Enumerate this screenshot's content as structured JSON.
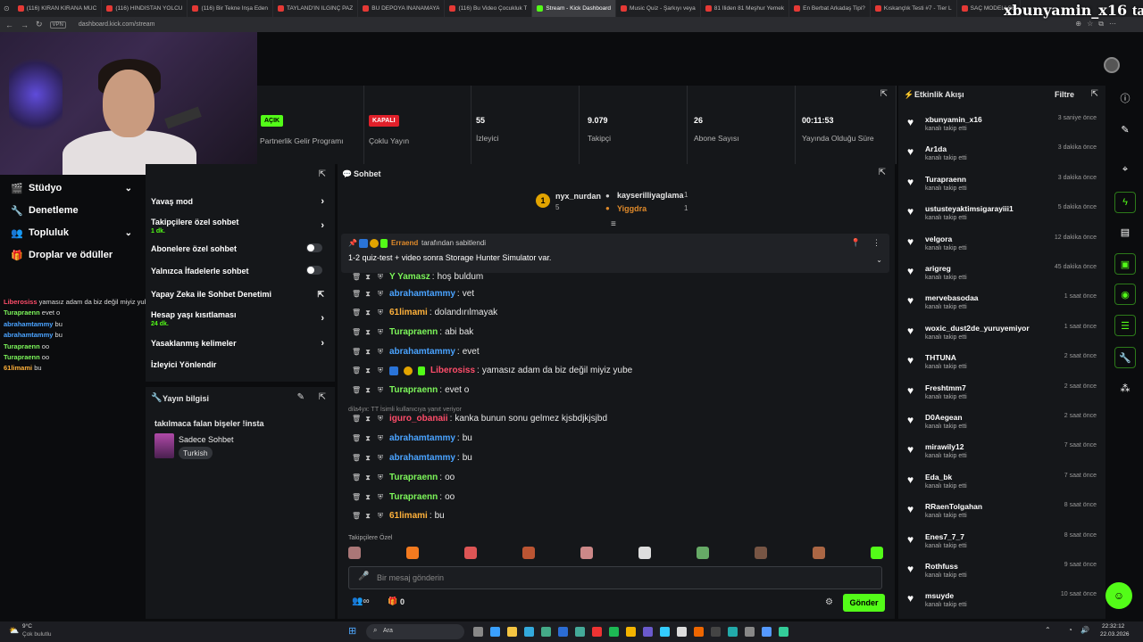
{
  "browser": {
    "tabs": [
      {
        "label": "(116) KIRAN KIRANA MÜC"
      },
      {
        "label": "(116) HİNDİSTAN YOLCU"
      },
      {
        "label": "(116) Bir Tekne İnşa Eden"
      },
      {
        "label": "TAYLAND'IN İLGİNÇ PAZ"
      },
      {
        "label": "BU DEPOYA İNANAMAYA"
      },
      {
        "label": "(116) Bu Video Çocukluk T"
      },
      {
        "label": "Stream - Kick Dashboard",
        "active": true
      },
      {
        "label": "Music Quiz - Şarkıyı veya"
      },
      {
        "label": "81 İliden 81 Meşhur Yemek"
      },
      {
        "label": "En Berbat Arkadaş Tipi?"
      },
      {
        "label": "Kıskançlık Testi #7 - Tier L"
      },
      {
        "label": "SAÇ MODELİ SE"
      }
    ],
    "url": "dashboard.kick.com/stream",
    "vpn_label": "VPN",
    "overlay_user": "xbunyamin_x16",
    "overlay_suffix": "takip"
  },
  "left_nav": [
    {
      "label": "Stüdyo",
      "icon": "film-icon",
      "chevron": true
    },
    {
      "label": "Denetleme",
      "icon": "wrench-icon",
      "chevron": false
    },
    {
      "label": "Topluluk",
      "icon": "people-icon",
      "chevron": true
    },
    {
      "label": "Droplar ve ödüller",
      "icon": "gift-icon",
      "chevron": false
    }
  ],
  "chat_overlay": [
    {
      "user": "Liberosiss",
      "text": "yamasız adam da biz değil miyiz yube",
      "color": "#ff4d6a"
    },
    {
      "user": "Turapraenn",
      "text": "evet o",
      "color": "#7cf55a"
    },
    {
      "user": "abrahamtammy",
      "text": "bu",
      "color": "#4aa3ff"
    },
    {
      "user": "abrahamtammy",
      "text": "bu",
      "color": "#4aa3ff"
    },
    {
      "user": "Turapraenn",
      "text": "oo",
      "color": "#7cf55a"
    },
    {
      "user": "Turapraenn",
      "text": "oo",
      "color": "#7cf55a"
    },
    {
      "user": "61limami",
      "text": "bu",
      "color": "#ffb13b"
    }
  ],
  "stats": [
    {
      "badge": "AÇIK",
      "badge_color": "#53fc18",
      "label": "Partnerlik Gelir Programı"
    },
    {
      "badge": "KAPALI",
      "badge_color": "#e0202a",
      "label": "Çoklu Yayın"
    },
    {
      "value": "55",
      "label": "İzleyici"
    },
    {
      "value": "9.079",
      "label": "Takipçi"
    },
    {
      "value": "26",
      "label": "Abone Sayısı"
    },
    {
      "value": "00:11:53",
      "label": "Yayında Olduğu Süre"
    }
  ],
  "chat_settings": {
    "rows": [
      {
        "label": "Yavaş mod",
        "type": "arrow"
      },
      {
        "label": "Takipçilere özel sohbet",
        "sub": "1 dk.",
        "type": "arrow"
      },
      {
        "label": "Abonelere özel sohbet",
        "type": "toggle"
      },
      {
        "label": "Yalnızca İfadelerle sohbet",
        "type": "toggle"
      },
      {
        "label": "Yapay Zeka ile Sohbet Denetimi",
        "type": "external"
      },
      {
        "label": "Hesap yaşı kısıtlaması",
        "sub": "24 dk.",
        "type": "arrow"
      },
      {
        "label": "Yasaklanmış kelimeler",
        "type": "arrow"
      },
      {
        "label": "İzleyici Yönlendir",
        "type": "none"
      }
    ]
  },
  "stream_info": {
    "title": "Yayın bilgisi",
    "stream_title": "takılmaca falan bişeler !insta",
    "category": "Sadece Sohbet",
    "language": "Turkish"
  },
  "chat": {
    "title": "Sohbet",
    "top_gifters": [
      {
        "name": "nyx_nurdan",
        "count": "5"
      },
      {
        "name": "kayserilliyaglama",
        "count": "1"
      },
      {
        "name": "Yiggdra",
        "count": "1"
      }
    ],
    "pinned": {
      "pinned_by": "Erraend",
      "pinned_by_suffix": "tarafından sabitlendi",
      "text": "1-2 quiz-test + video sonra Storage Hunter Simulator var."
    },
    "reply_hint": "dila4yx: TT İsimli kullanıcıya yanıt veriyor",
    "messages": [
      {
        "user": "Y Yamasz",
        "text": "hoş buldum",
        "color": "#7cf55a"
      },
      {
        "user": "abrahamtammy",
        "text": "vet",
        "color": "#4aa3ff"
      },
      {
        "user": "61limami",
        "text": "dolandırılmayak",
        "color": "#ffb13b"
      },
      {
        "user": "Turapraenn",
        "text": "abi bak",
        "color": "#7cf55a"
      },
      {
        "user": "abrahamtammy",
        "text": "evet",
        "color": "#4aa3ff"
      },
      {
        "user": "Liberosiss",
        "text": "yamasız adam da biz değil miyiz yube",
        "color": "#ff4d6a"
      },
      {
        "user": "Turapraenn",
        "text": "evet o",
        "color": "#7cf55a"
      },
      {
        "user": "iguro_obanaii",
        "text": "kanka bunun sonu gelmez kjsbdjkjsjbd",
        "color": "#ff4d6a"
      },
      {
        "user": "abrahamtammy",
        "text": "bu",
        "color": "#4aa3ff"
      },
      {
        "user": "abrahamtammy",
        "text": "bu",
        "color": "#4aa3ff"
      },
      {
        "user": "Turapraenn",
        "text": "oo",
        "color": "#7cf55a"
      },
      {
        "user": "Turapraenn",
        "text": "oo",
        "color": "#7cf55a"
      },
      {
        "user": "61limami",
        "text": "bu",
        "color": "#ffb13b"
      }
    ],
    "followers_only_label": "Takipçilere Özel",
    "input_placeholder": "Bir mesaj gönderin",
    "send_label": "Gönder",
    "viewer_count": "0"
  },
  "activity": {
    "title": "Etkinlik Akışı",
    "filter_label": "Filtre",
    "events": [
      {
        "name": "xbunyamin_x16",
        "desc": "kanalı takip etti",
        "time": "3 saniye önce"
      },
      {
        "name": "Ar1da",
        "desc": "kanalı takip etti",
        "time": "3 dakika önce"
      },
      {
        "name": "Turapraenn",
        "desc": "kanalı takip etti",
        "time": "3 dakika önce"
      },
      {
        "name": "ustusteyaktimsigarayiii1",
        "desc": "kanalı takip etti",
        "time": "5 dakika önce"
      },
      {
        "name": "velgora",
        "desc": "kanalı takip etti",
        "time": "12 dakika önce"
      },
      {
        "name": "arigreg",
        "desc": "kanalı takip etti",
        "time": "45 dakika önce"
      },
      {
        "name": "mervebasodaa",
        "desc": "kanalı takip etti",
        "time": "1 saat önce"
      },
      {
        "name": "woxic_dust2de_yuruyemiyor",
        "desc": "kanalı takip etti",
        "time": "1 saat önce"
      },
      {
        "name": "THTUNA",
        "desc": "kanalı takip etti",
        "time": "2 saat önce"
      },
      {
        "name": "Freshtmm7",
        "desc": "kanalı takip etti",
        "time": "2 saat önce"
      },
      {
        "name": "D0Aegean",
        "desc": "kanalı takip etti",
        "time": "2 saat önce"
      },
      {
        "name": "mirawily12",
        "desc": "kanalı takip etti",
        "time": "7 saat önce"
      },
      {
        "name": "Eda_bk",
        "desc": "kanalı takip etti",
        "time": "7 saat önce"
      },
      {
        "name": "RRaenTolgahan",
        "desc": "kanalı takip etti",
        "time": "8 saat önce"
      },
      {
        "name": "Enes7_7_7",
        "desc": "kanalı takip etti",
        "time": "8 saat önce"
      },
      {
        "name": "Rothfuss",
        "desc": "kanalı takip etti",
        "time": "9 saat önce"
      },
      {
        "name": "msuyde",
        "desc": "kanalı takip etti",
        "time": "10 saat önce"
      }
    ]
  },
  "taskbar": {
    "weather_temp": "9°C",
    "weather_desc": "Çok bulutlu",
    "search_label": "Ara",
    "time": "22:32:12",
    "date": "22.03.2026"
  },
  "colors": {
    "accent": "#53fc18",
    "panel": "#15171a",
    "bg": "#0b0c0e"
  }
}
